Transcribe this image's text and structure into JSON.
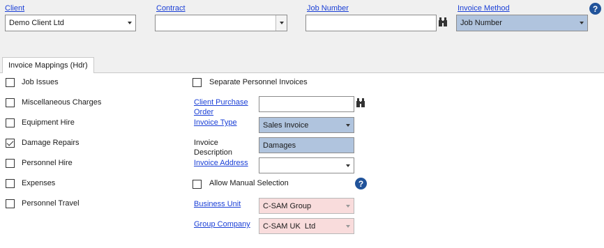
{
  "header": {
    "client": {
      "label": "Client",
      "value": "Demo Client Ltd"
    },
    "contract": {
      "label": "Contract",
      "value": ""
    },
    "job_number": {
      "label": "Job Number",
      "value": ""
    },
    "invoice_method": {
      "label": "Invoice Method",
      "value": "Job Number"
    },
    "help_glyph": "?"
  },
  "tab": {
    "label": "Invoice Mappings (Hdr)"
  },
  "left_checkboxes": [
    {
      "label": "Job Issues",
      "checked": false
    },
    {
      "label": "Miscellaneous Charges",
      "checked": false
    },
    {
      "label": "Equipment Hire",
      "checked": false
    },
    {
      "label": "Damage Repairs",
      "checked": true
    },
    {
      "label": "Personnel Hire",
      "checked": false
    },
    {
      "label": "Expenses",
      "checked": false
    },
    {
      "label": "Personnel Travel",
      "checked": false
    }
  ],
  "right": {
    "separate_personnel": {
      "label": "Separate Personnel Invoices",
      "checked": false
    },
    "client_po": {
      "label_line1": "Client Purchase",
      "label_line2": "Order",
      "value": ""
    },
    "invoice_type": {
      "label": "Invoice Type",
      "value": "Sales Invoice"
    },
    "invoice_description": {
      "label_line1": "Invoice",
      "label_line2": "Description",
      "value": "Damages"
    },
    "invoice_address": {
      "label": "Invoice Address",
      "value": ""
    },
    "allow_manual": {
      "label": "Allow Manual Selection",
      "checked": false
    },
    "business_unit": {
      "label": "Business Unit",
      "value": "C-SAM Group"
    },
    "group_company": {
      "label": "Group Company",
      "value": "C-SAM UK  Ltd"
    },
    "help_glyph": "?"
  },
  "colors": {
    "link": "#1a3fd6",
    "readonly_blue": "#b0c4de",
    "readonly_pink": "#f9dcdc",
    "help_icon": "#21539a"
  }
}
